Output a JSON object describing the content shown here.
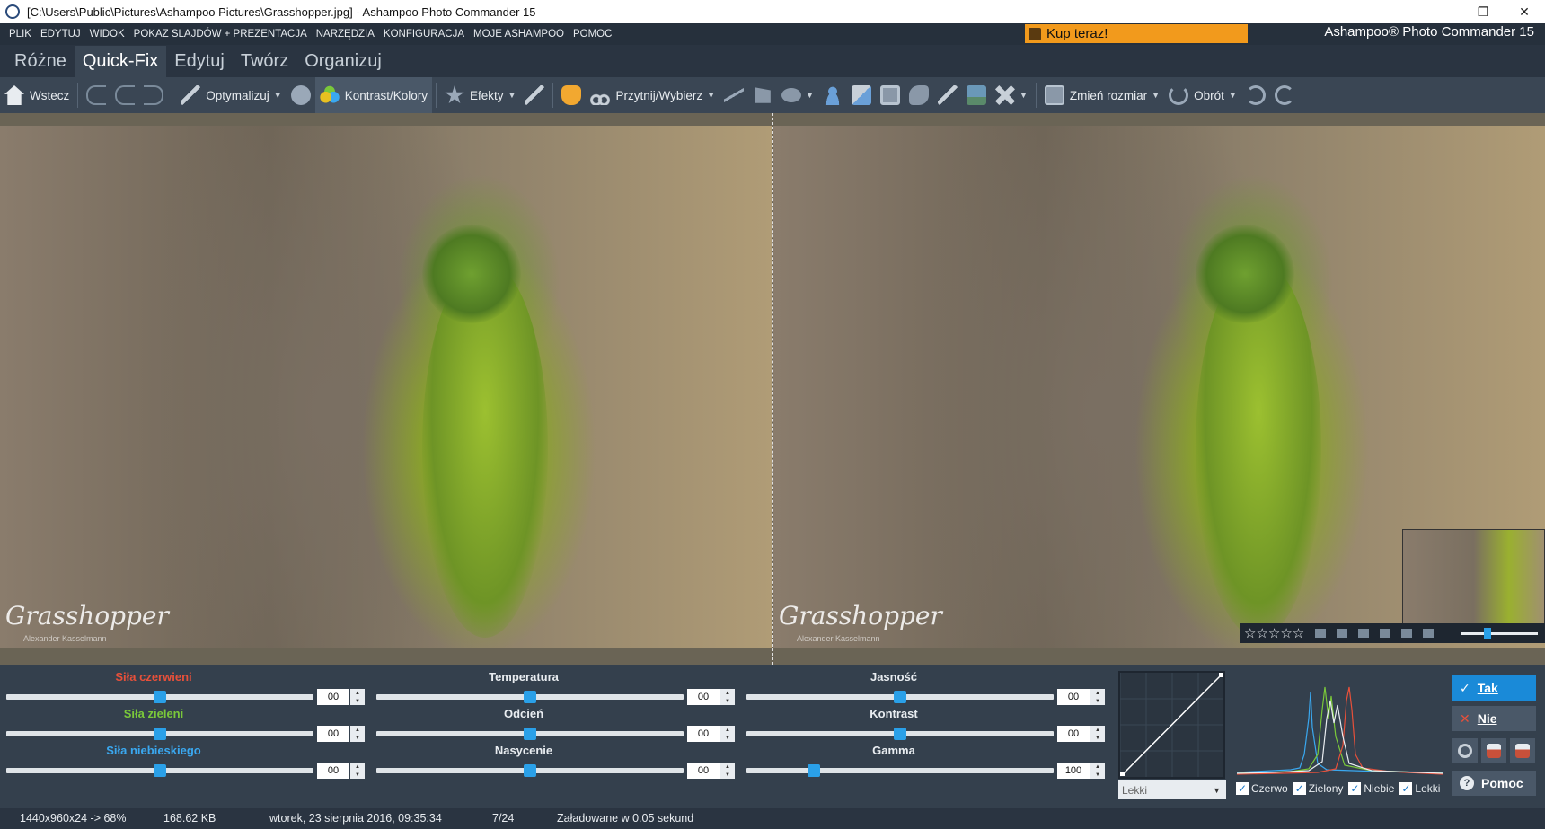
{
  "window": {
    "title": "[C:\\Users\\Public\\Pictures\\Ashampoo Pictures\\Grasshopper.jpg] - Ashampoo Photo Commander 15",
    "minimize": "—",
    "maximize": "❐",
    "close": "✕"
  },
  "menu": [
    "PLIK",
    "EDYTUJ",
    "WIDOK",
    "POKAZ SLAJDÓW + PREZENTACJA",
    "NARZĘDZIA",
    "KONFIGURACJA",
    "MOJE ASHAMPOO",
    "POMOC"
  ],
  "buy_now": "Kup teraz!",
  "brand": "Ashampoo® Photo Commander 15",
  "tabs": [
    {
      "label": "Różne",
      "active": false
    },
    {
      "label": "Quick-Fix",
      "active": true
    },
    {
      "label": "Edytuj",
      "active": false
    },
    {
      "label": "Twórz",
      "active": false
    },
    {
      "label": "Organizuj",
      "active": false
    }
  ],
  "toolbar": {
    "back": "Wstecz",
    "optimize": "Optymalizuj",
    "contrast_colors": "Kontrast/Kolory",
    "effects": "Efekty",
    "crop": "Przytnij/Wybierz",
    "resize": "Zmień rozmiar",
    "rotate": "Obrót"
  },
  "colors": {
    "accent": "#2aa0e8",
    "red_label": "#e8503a",
    "green_label": "#7ac83a",
    "blue_label": "#3aa8f0",
    "buy_now": "#f29a1c"
  },
  "photo": {
    "watermark": "Grasshopper",
    "watermark_sub": "Alexander Kasselmann"
  },
  "thumbnail": {
    "rating_stars": "☆☆☆☆☆",
    "zoom_fraction": 0.35
  },
  "sliders": {
    "red": {
      "label": "Siła czerwieni",
      "value": "00",
      "position": 0.5
    },
    "green": {
      "label": "Siła zieleni",
      "value": "00",
      "position": 0.5
    },
    "blue": {
      "label": "Siła niebieskiego",
      "value": "00",
      "position": 0.5
    },
    "temperature": {
      "label": "Temperatura",
      "value": "00",
      "position": 0.5
    },
    "hue": {
      "label": "Odcień",
      "value": "00",
      "position": 0.5
    },
    "saturation": {
      "label": "Nasycenie",
      "value": "00",
      "position": 0.5
    },
    "brightness": {
      "label": "Jasność",
      "value": "00",
      "position": 0.5
    },
    "contrast": {
      "label": "Kontrast",
      "value": "00",
      "position": 0.5
    },
    "gamma": {
      "label": "Gamma",
      "value": "100",
      "position": 0.22
    }
  },
  "curve": {
    "preset": "Lekki"
  },
  "histogram": {
    "checks": [
      {
        "label": "Czerwo",
        "checked": true
      },
      {
        "label": "Zielony",
        "checked": true
      },
      {
        "label": "Niebie",
        "checked": true
      },
      {
        "label": "Lekki",
        "checked": true
      }
    ]
  },
  "actions": {
    "yes": "Tak",
    "no": "Nie",
    "help": "Pomoc"
  },
  "status": {
    "dimensions": "1440x960x24 -> 68%",
    "filesize": "168.62 KB",
    "date": "wtorek, 23 sierpnia 2016, 09:35:34",
    "index": "7/24",
    "loaded": "Załadowane w 0.05 sekund"
  }
}
